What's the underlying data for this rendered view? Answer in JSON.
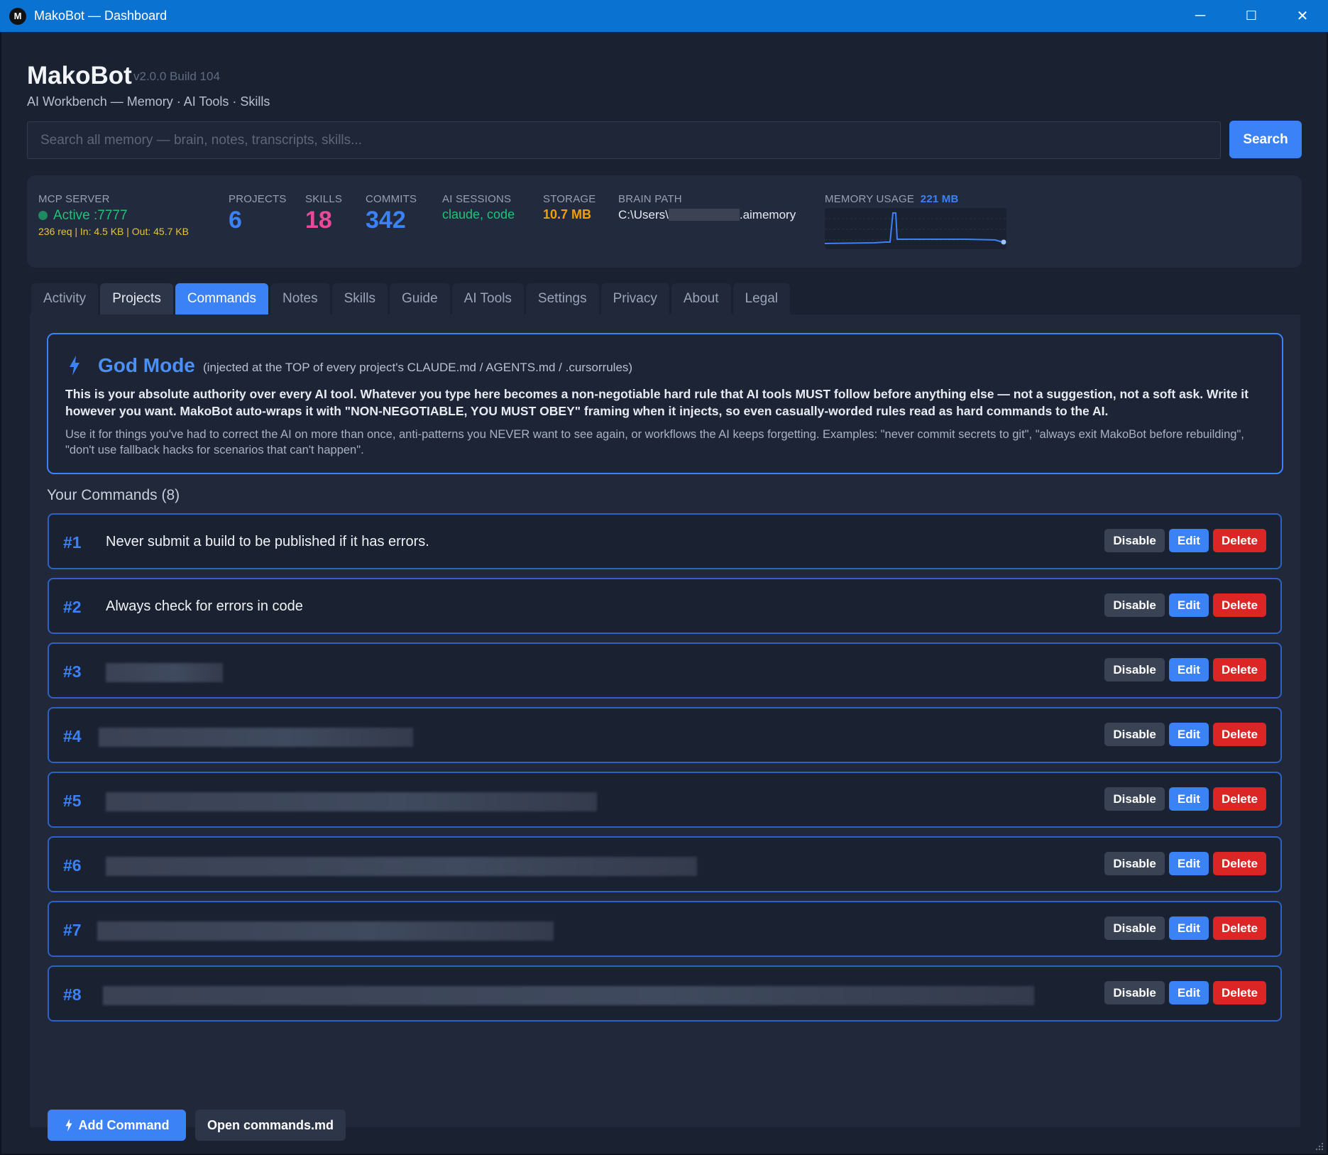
{
  "window": {
    "title": "MakoBot — Dashboard",
    "logo_letter": "M",
    "minimize": "─",
    "maximize": "☐",
    "close": "✕"
  },
  "header": {
    "app_name": "MakoBot",
    "version": "v2.0.0 Build 104",
    "subtitle": "AI Workbench — Memory · AI Tools · Skills"
  },
  "search": {
    "placeholder": "Search all memory — brain, notes, transcripts, skills...",
    "button_label": "Search"
  },
  "stats": {
    "mcp_server": {
      "label": "MCP SERVER",
      "status": "Active :7777",
      "traffic": "236 req | In: 4.5 KB | Out: 45.7 KB"
    },
    "projects": {
      "label": "PROJECTS",
      "value": "6"
    },
    "skills": {
      "label": "SKILLS",
      "value": "18"
    },
    "commits": {
      "label": "COMMITS",
      "value": "342"
    },
    "ai_sessions": {
      "label": "AI SESSIONS",
      "value": "claude, code"
    },
    "storage": {
      "label": "STORAGE",
      "value": "10.7 MB"
    },
    "brain_path": {
      "label": "BRAIN PATH",
      "prefix": "C:\\Users\\",
      "suffix": ".aimemory"
    },
    "memory_usage": {
      "label": "MEMORY USAGE",
      "value": "221 MB"
    }
  },
  "tabs": [
    {
      "label": "Activity"
    },
    {
      "label": "Projects"
    },
    {
      "label": "Commands"
    },
    {
      "label": "Notes"
    },
    {
      "label": "Skills"
    },
    {
      "label": "Guide"
    },
    {
      "label": "AI Tools"
    },
    {
      "label": "Settings"
    },
    {
      "label": "Privacy"
    },
    {
      "label": "About"
    },
    {
      "label": "Legal"
    }
  ],
  "godmode": {
    "title": "God Mode",
    "note": "(injected at the TOP of every project's CLAUDE.md / AGENTS.md / .cursorrules)",
    "description": "This is your absolute authority over every AI tool. Whatever you type here becomes a non-negotiable hard rule that AI tools MUST follow before anything else — not a suggestion, not a soft ask. Write it however you want. MakoBot auto-wraps it with \"NON-NEGOTIABLE, YOU MUST OBEY\" framing when it injects, so even casually-worded rules read as hard commands to the AI.",
    "hint": "Use it for things you've had to correct the AI on more than once, anti-patterns you NEVER want to see again, or workflows the AI keeps forgetting. Examples: \"never commit secrets to git\", \"always exit MakoBot before rebuilding\", \"don't use fallback hacks for scenarios that can't happen\"."
  },
  "commands": {
    "heading": "Your Commands (8)",
    "items": [
      {
        "num": "#1",
        "text": "Never submit a build to be published if it has errors."
      },
      {
        "num": "#2",
        "text": "Always check for errors in code"
      },
      {
        "num": "#3",
        "text": ""
      },
      {
        "num": "#4",
        "text": ""
      },
      {
        "num": "#5",
        "text": ""
      },
      {
        "num": "#6",
        "text": ""
      },
      {
        "num": "#7",
        "text": ""
      },
      {
        "num": "#8",
        "text": ""
      }
    ],
    "disable_label": "Disable",
    "edit_label": "Edit",
    "delete_label": "Delete",
    "add_label": "Add Command",
    "open_label": "Open commands.md"
  },
  "colors": {
    "accent": "#3b82f6",
    "danger": "#dc2626",
    "success": "#20c27a",
    "warning": "#e8c23a",
    "skills": "#ec4899",
    "storage": "#f59e0b"
  },
  "icons": {
    "bolt": "bolt-icon"
  }
}
